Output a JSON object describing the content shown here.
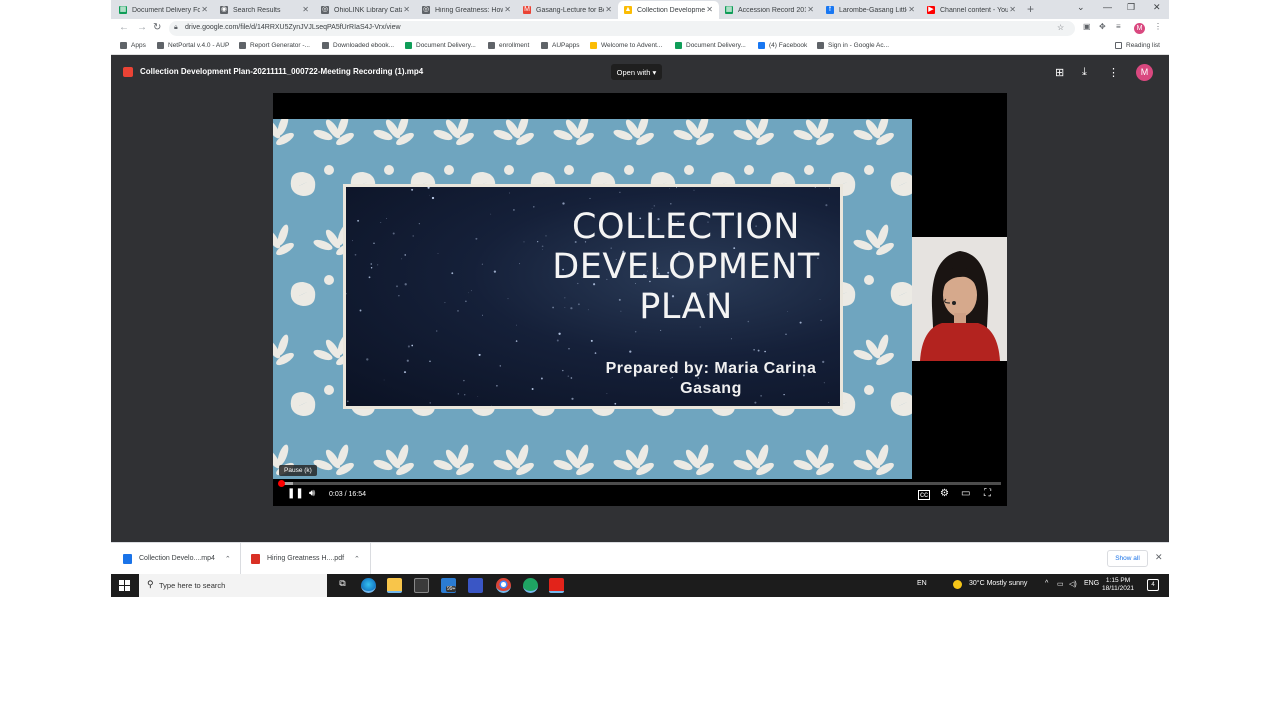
{
  "browser": {
    "tabs": [
      {
        "title": "Document Delivery Fo",
        "fav_color": "#0f9d58",
        "fav_glyph": "▦"
      },
      {
        "title": "Search Results",
        "fav_color": "#5f6368",
        "fav_glyph": "◉"
      },
      {
        "title": "OhioLINK Library Cata",
        "fav_color": "#5f6368",
        "fav_glyph": "◎"
      },
      {
        "title": "Hiring Greatness: How",
        "fav_color": "#5f6368",
        "fav_glyph": "◎"
      },
      {
        "title": "Gasang-Lecture for Bo",
        "fav_color": "#ea4335",
        "fav_glyph": "M"
      },
      {
        "title": "Collection Developme",
        "fav_color": "#fbbc04",
        "fav_glyph": "▲"
      },
      {
        "title": "Accession Record 201",
        "fav_color": "#0f9d58",
        "fav_glyph": "▦"
      },
      {
        "title": "Larombe-Gasang Little",
        "fav_color": "#1877f2",
        "fav_glyph": "f"
      },
      {
        "title": "Channel content - You",
        "fav_color": "#ff0000",
        "fav_glyph": "▶"
      }
    ],
    "active_tab": 5,
    "new_tab": "+",
    "url": "drive.google.com/file/d/14RRXU5ZynJVJLseqPA5fUrRIaS4J-Vrx/view",
    "profile_initial": "M",
    "bookmarks": [
      {
        "label": "Apps",
        "color": "#5f6368"
      },
      {
        "label": "NetPortal v.4.0 - AUP",
        "color": "#5f6368"
      },
      {
        "label": "Report Generator -...",
        "color": "#5f6368"
      },
      {
        "label": "Downloaded ebook...",
        "color": "#5f6368"
      },
      {
        "label": "Document Delivery...",
        "color": "#0f9d58"
      },
      {
        "label": "enrollment",
        "color": "#5f6368"
      },
      {
        "label": "AUPapps",
        "color": "#5f6368"
      },
      {
        "label": "Welcome to Advent...",
        "color": "#fbbc04"
      },
      {
        "label": "Document Delivery...",
        "color": "#0f9d58"
      },
      {
        "label": "(4) Facebook",
        "color": "#1877f2"
      },
      {
        "label": "Sign in - Google Ac...",
        "color": "#5f6368"
      }
    ],
    "reading_list": "Reading list"
  },
  "viewer": {
    "file_title": "Collection Development Plan-20211111_000722-Meeting Recording (1).mp4",
    "open_with": "Open with",
    "avatar_initial": "M"
  },
  "video": {
    "slide_title_lines": [
      "COLLECTION",
      "DEVELOPMENT",
      "PLAN"
    ],
    "slide_subtitle_lines": [
      "Prepared by: Maria Carina",
      "Gasang"
    ],
    "tooltip": "Pause (k)",
    "time": "0:03 / 16:54",
    "progress_fraction": 0.003,
    "buffered_fraction": 0.02
  },
  "downloads": {
    "items": [
      {
        "name": "Collection Develo....mp4",
        "icon_color": "#1a73e8"
      },
      {
        "name": "Hiring Greatness H....pdf",
        "icon_color": "#d93025"
      }
    ],
    "show_all": "Show all"
  },
  "taskbar": {
    "search_placeholder": "Type here to search",
    "lang": "EN",
    "weather": "30°C  Mostly sunny",
    "input_lang": "ENG",
    "time": "1:15 PM",
    "date": "18/11/2021",
    "notification_count": "4",
    "mail_badge": "99+"
  }
}
